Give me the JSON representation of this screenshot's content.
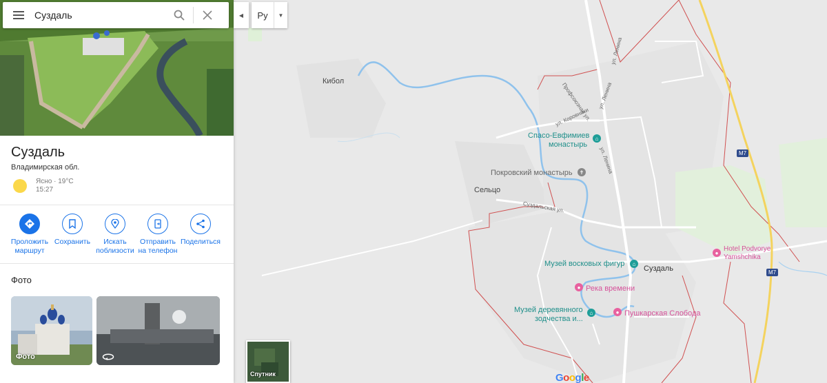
{
  "search": {
    "value": "Суздаль"
  },
  "place": {
    "title": "Суздаль",
    "region": "Владимирская обл.",
    "weather_line1": "Ясно · 19°C",
    "weather_line2": "15:27"
  },
  "actions": [
    {
      "label": "Проложить маршрут",
      "icon": "directions-icon"
    },
    {
      "label": "Сохранить",
      "icon": "bookmark-icon"
    },
    {
      "label": "Искать поблизости",
      "icon": "nearby-icon"
    },
    {
      "label": "Отправить на телефон",
      "icon": "phone-icon"
    },
    {
      "label": "Поделиться",
      "icon": "share-icon"
    }
  ],
  "photos": {
    "heading": "Фото",
    "items": [
      {
        "label": "Фото"
      },
      {
        "label": ""
      }
    ]
  },
  "lang": {
    "label": "Ру"
  },
  "satellite": {
    "label": "Спутник"
  },
  "map": {
    "labels": {
      "kibol": "Кибол",
      "selco": "Сельцо",
      "spaso": "Спасо-Евфимиев",
      "spaso2": "монастырь",
      "pokrov": "Покровский монастырь",
      "suzdal": "Суздаль",
      "wax": "Музей восковых фигур",
      "river": "Река времени",
      "wood1": "Музей деревянного",
      "wood2": "зодчества и...",
      "pushkar": "Пушкарская Слобода",
      "hotel1": "Hotel Podvorye",
      "hotel2": "Yamshchika",
      "m7a": "M7",
      "m7b": "M7",
      "st_lenina1": "ул. Ленина",
      "st_lenina2": "ул. Ленина",
      "st_lenina3": "ул. Ленина",
      "st_profsoyuz": "Профсоюзная ул.",
      "st_korovniki": "ул. Коровники",
      "st_suzdal": "Суздальская ул."
    },
    "logo": "Google"
  },
  "colors": {
    "accent": "#1a73e8",
    "map_bg": "#e9e9e9",
    "river": "#8fc2ec",
    "boundary": "#d05050",
    "highway": "#f4d35e",
    "teal_poi": "#1f9e98",
    "pink_poi": "#e8619f"
  }
}
